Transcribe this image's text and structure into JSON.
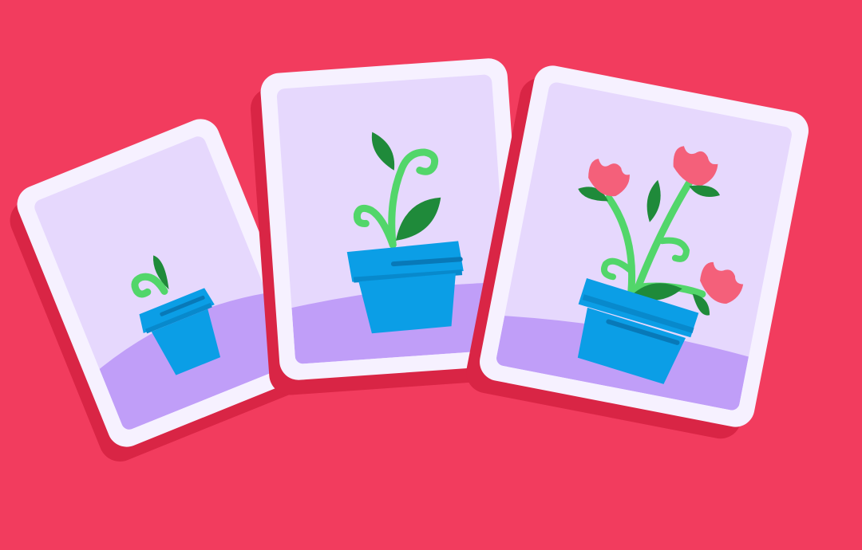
{
  "scene": {
    "background_color": "#f23c5e",
    "card_border_color": "#f6f1ff",
    "card_inner_color": "#e6d8fd",
    "ground_color": "#c09ef8",
    "pot_color": "#0b9ee6",
    "pot_rim_color": "#0889cc",
    "leaf_color": "#1f8a3a",
    "vine_color": "#52d66a",
    "flower_color": "#f4607a"
  },
  "cards": [
    {
      "name": "seedling-card",
      "stage": "seedling",
      "icon": "seedling-in-pot-icon"
    },
    {
      "name": "sprout-card",
      "stage": "sprout",
      "icon": "sprout-in-pot-icon"
    },
    {
      "name": "flowering-card",
      "stage": "flowering",
      "icon": "flowering-plant-in-pot-icon"
    }
  ]
}
